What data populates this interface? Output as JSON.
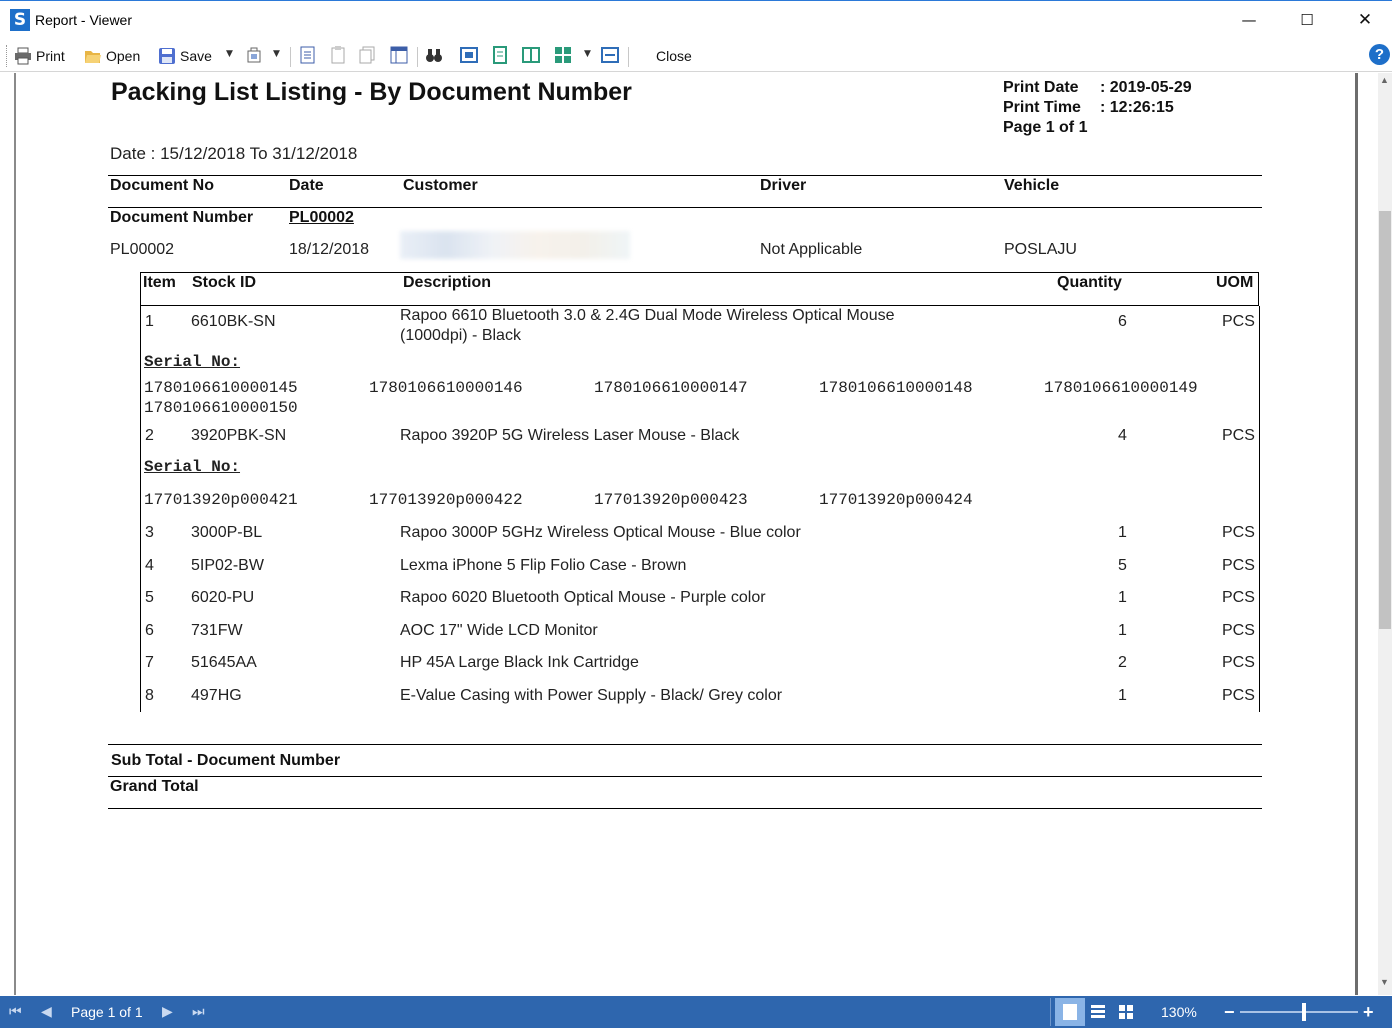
{
  "window": {
    "title": "Report - Viewer",
    "logo": "S",
    "minimize": "—",
    "maximize": "☐",
    "close": "✕"
  },
  "toolbar": {
    "print_label": "Print",
    "open_label": "Open",
    "save_label": "Save",
    "close_label": "Close",
    "help_label": "?"
  },
  "report": {
    "title": "Packing List Listing - By Document Number",
    "print_date_label": "Print Date",
    "print_date_value": ": 2019-05-29",
    "print_time_label": "Print Time",
    "print_time_value": ": 12:26:15",
    "page_info": "Page 1 of 1",
    "date_range": "Date : 15/12/2018 To 31/12/2018",
    "headers": {
      "document_no": "Document No",
      "date": "Date",
      "customer": "Customer",
      "driver": "Driver",
      "vehicle": "Vehicle"
    },
    "group_label": "Document Number",
    "group_value": "PL00002",
    "document": {
      "number": "PL00002",
      "date": "18/12/2018",
      "driver": "Not Applicable",
      "vehicle": "POSLAJU"
    },
    "item_headers": {
      "item": "Item",
      "stock_id": "Stock ID",
      "description": "Description",
      "quantity": "Quantity",
      "uom": "UOM"
    },
    "items": [
      {
        "no": "1",
        "stock_id": "6610BK-SN",
        "desc1": "Rapoo 6610 Bluetooth 3.0 & 2.4G Dual Mode Wireless Optical Mouse",
        "desc2": "(1000dpi) - Black",
        "qty": "6",
        "uom": "PCS"
      },
      {
        "no": "2",
        "stock_id": "3920PBK-SN",
        "desc1": "Rapoo 3920P 5G Wireless Laser Mouse - Black",
        "qty": "4",
        "uom": "PCS"
      },
      {
        "no": "3",
        "stock_id": "3000P-BL",
        "desc1": "Rapoo 3000P 5GHz Wireless Optical Mouse - Blue color",
        "qty": "1",
        "uom": "PCS"
      },
      {
        "no": "4",
        "stock_id": "5IP02-BW",
        "desc1": "Lexma iPhone 5 Flip Folio Case - Brown",
        "qty": "5",
        "uom": "PCS"
      },
      {
        "no": "5",
        "stock_id": "6020-PU",
        "desc1": "Rapoo 6020 Bluetooth Optical Mouse - Purple color",
        "qty": "1",
        "uom": "PCS"
      },
      {
        "no": "6",
        "stock_id": "731FW",
        "desc1": "AOC 17\" Wide LCD Monitor",
        "qty": "1",
        "uom": "PCS"
      },
      {
        "no": "7",
        "stock_id": "51645AA",
        "desc1": "HP 45A Large Black Ink Cartridge",
        "qty": "2",
        "uom": "PCS"
      },
      {
        "no": "8",
        "stock_id": "497HG",
        "desc1": "E-Value Casing with Power Supply - Black/ Grey color",
        "qty": "1",
        "uom": "PCS"
      }
    ],
    "serial_label": "Serial No:",
    "serials_1": [
      "1780106610000145",
      "1780106610000146",
      "1780106610000147",
      "1780106610000148",
      "1780106610000149",
      "1780106610000150"
    ],
    "serials_2": [
      "177013920p000421",
      "177013920p000422",
      "177013920p000423",
      "177013920p000424"
    ],
    "subtotal_label": "Sub Total - Document Number",
    "grand_total_label": "Grand Total"
  },
  "statusbar": {
    "page_label": "Page 1 of 1",
    "zoom": "130%",
    "zoom_minus": "−",
    "zoom_plus": "+"
  }
}
